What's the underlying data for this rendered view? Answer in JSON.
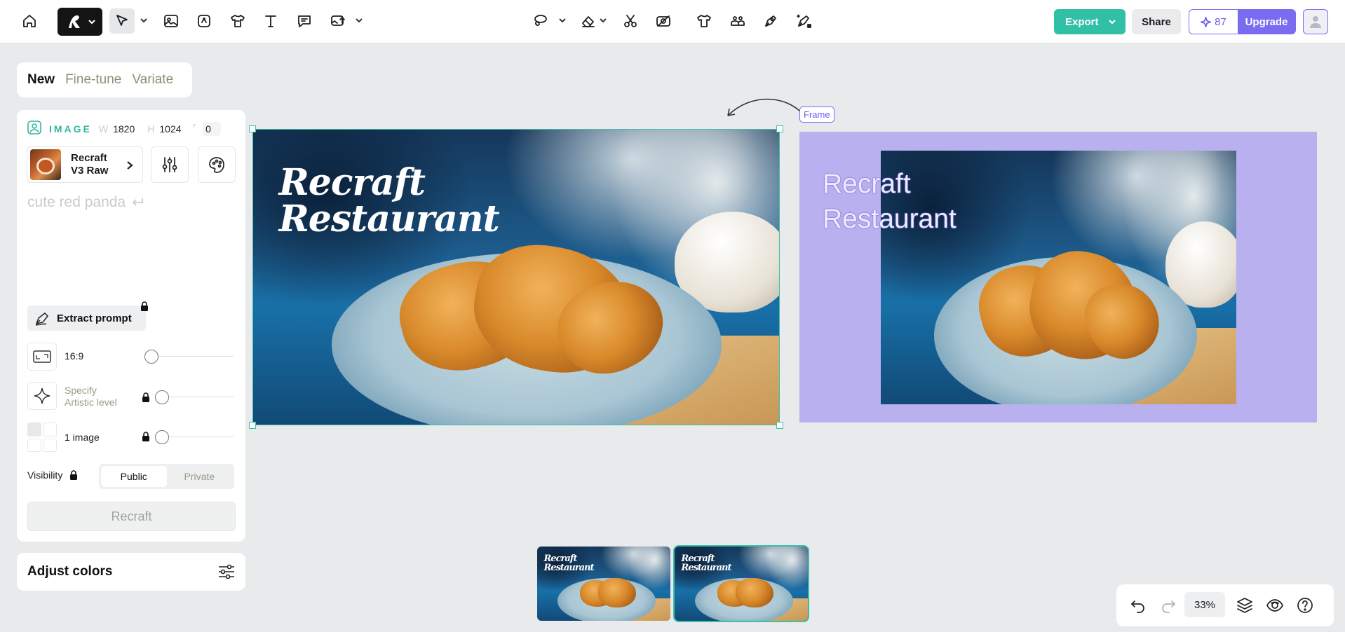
{
  "toolbar": {
    "left_tools": [
      "home-icon",
      "select-icon",
      "image-icon",
      "vector-icon",
      "mockup-icon",
      "text-icon",
      "chat-icon",
      "image-upload-icon"
    ],
    "center_tools": [
      "lasso-icon",
      "eraser-icon",
      "scissors-icon",
      "remove-bg-icon",
      "tshirt-icon",
      "people-icon",
      "pen-icon",
      "magic-pen-icon"
    ],
    "export_label": "Export",
    "share_label": "Share",
    "credits": "87",
    "upgrade_label": "Upgrade"
  },
  "panel": {
    "tabs": [
      "New",
      "Fine-tune",
      "Variate"
    ],
    "image_label": "IMAGE",
    "w_label": "W",
    "w_value": "1820",
    "h_label": "H",
    "h_value": "1024",
    "corner_value": "0",
    "model_name": "Recraft V3 Raw",
    "prompt_placeholder": "cute red panda",
    "extract_label": "Extract prompt",
    "aspect_ratio": "16:9",
    "artistic_label": "Specify Artistic level",
    "images_label": "1 image",
    "visibility_label": "Visibility",
    "visibility_options": [
      "Public",
      "Private"
    ],
    "visibility_selected": "Public",
    "recraft_label": "Recraft",
    "adjust_colors_label": "Adjust colors"
  },
  "canvas": {
    "image_title_line1": "Recraft",
    "image_title_line2": "Restaurant",
    "frame_tag": "Frame",
    "frame_title_line1": "Recraft",
    "frame_title_line2": "Restaurant",
    "thumb_title_line1": "Recraft",
    "thumb_title_line2": "Restaurant"
  },
  "bottom": {
    "zoom": "33%"
  },
  "colors": {
    "accent": "#2fc0a6",
    "brand_purple": "#7a6cf0",
    "frame_fill": "#b9b0ef"
  }
}
